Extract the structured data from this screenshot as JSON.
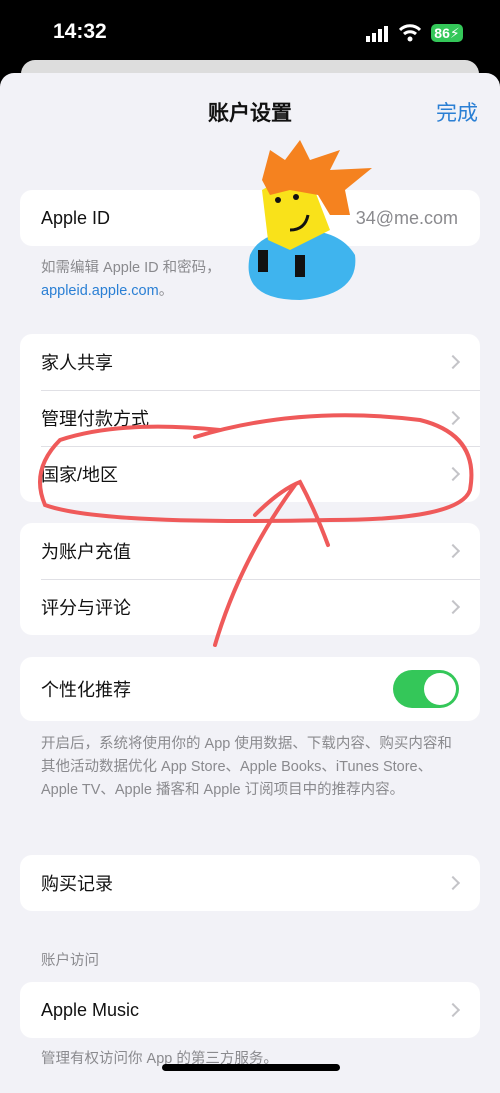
{
  "status": {
    "time": "14:32",
    "battery": "86",
    "icons": [
      "signal-icon",
      "wifi-icon",
      "battery-charging-icon"
    ]
  },
  "nav": {
    "title": "账户设置",
    "done": "完成"
  },
  "apple_id": {
    "label": "Apple ID",
    "value": "34@me.com",
    "footnote": "如需编辑 Apple ID 和密码，",
    "link": "appleid.apple.com",
    "link_suffix": "。"
  },
  "group1": [
    {
      "label": "家人共享"
    },
    {
      "label": "管理付款方式"
    },
    {
      "label": "国家/地区"
    }
  ],
  "group2": [
    {
      "label": "为账户充值"
    },
    {
      "label": "评分与评论"
    }
  ],
  "personalized": {
    "label": "个性化推荐",
    "enabled": true,
    "footnote": "开启后，系统将使用你的 App 使用数据、下载内容、购买内容和其他活动数据优化 App Store、Apple Books、iTunes Store、Apple TV、Apple 播客和 Apple 订阅项目中的推荐内容。"
  },
  "purchase": {
    "label": "购买记录"
  },
  "access": {
    "header": "账户访问",
    "label": "Apple Music",
    "footnote": "管理有权访问你 App 的第三方服务。"
  },
  "colors": {
    "accent": "#2a7fd4",
    "toggle": "#34c759",
    "annotation": "#ef5a5a"
  }
}
